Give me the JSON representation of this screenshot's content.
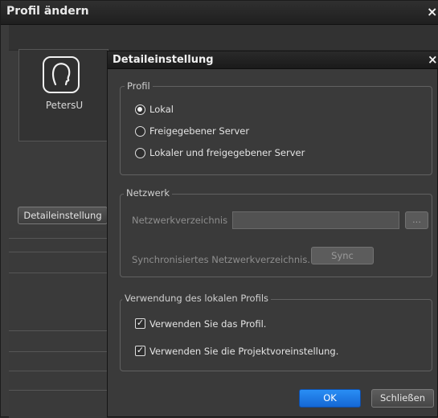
{
  "back_window": {
    "title": "Profil ändern",
    "close_glyph": "×",
    "profile_name": "PetersU",
    "detail_button": "Detaileinstellung"
  },
  "dialog": {
    "title": "Detaileinstellung",
    "close_glyph": "×",
    "profile_group": {
      "legend": "Profil",
      "options": [
        {
          "label": "Lokal",
          "selected": true
        },
        {
          "label": "Freigegebener Server",
          "selected": false
        },
        {
          "label": "Lokaler und freigegebener Server",
          "selected": false
        }
      ]
    },
    "network_group": {
      "legend": "Netzwerk",
      "directory_label": "Netzwerkverzeichnis",
      "directory_value": "",
      "browse_label": "...",
      "sync_dir_label": "Synchronisiertes Netzwerkverzeichnis.",
      "sync_button": "Sync"
    },
    "local_profile_group": {
      "legend": "Verwendung des lokalen Profils",
      "checkboxes": [
        {
          "label": "Verwenden Sie das Profil.",
          "checked": true
        },
        {
          "label": "Verwenden Sie die Projektvoreinstellung.",
          "checked": true
        }
      ]
    },
    "ok_button": "OK",
    "close_button": "Schließen"
  },
  "colors": {
    "accent_button": "#1877e6",
    "background": "#3a3a3a"
  },
  "icons": {
    "avatar": "user-profile-icon",
    "radio_selected": "radio-selected-icon",
    "checkbox_checked": "checkmark-icon"
  }
}
